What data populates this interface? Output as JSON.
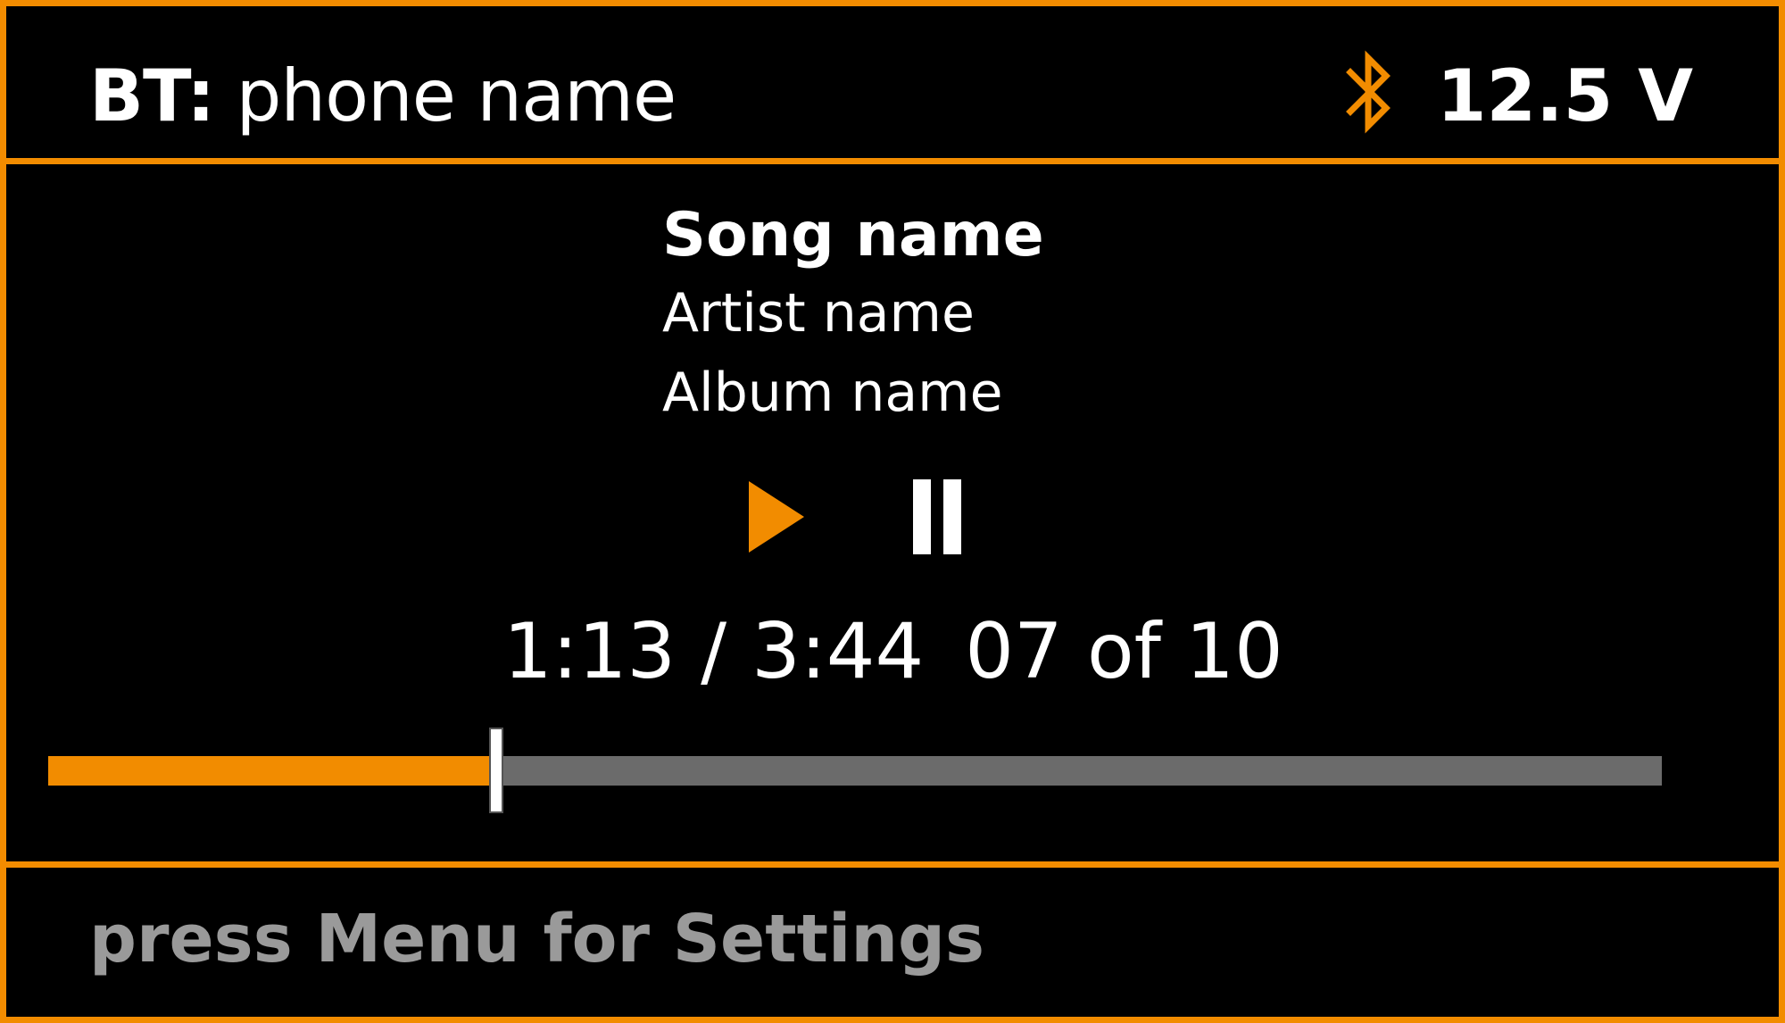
{
  "header": {
    "connection_prefix": "BT:",
    "connection_name": "phone name",
    "voltage": "12.5 V",
    "bluetooth_icon": "bluetooth-icon"
  },
  "track": {
    "song": "Song name",
    "artist": "Artist name",
    "album": "Album name"
  },
  "controls": {
    "play_icon": "play-icon",
    "pause_icon": "pause-icon"
  },
  "time": {
    "elapsed": "1:13",
    "separator": "/",
    "total": "3:44",
    "track_position": "07 of 10",
    "progress_fraction": 0.2774
  },
  "footer": {
    "hint": "press Menu for Settings"
  },
  "colors": {
    "accent": "#f28c00",
    "background": "#000000",
    "text": "#ffffff",
    "hint_text": "#9a9a9a",
    "track_remaining": "#6b6b6b"
  }
}
